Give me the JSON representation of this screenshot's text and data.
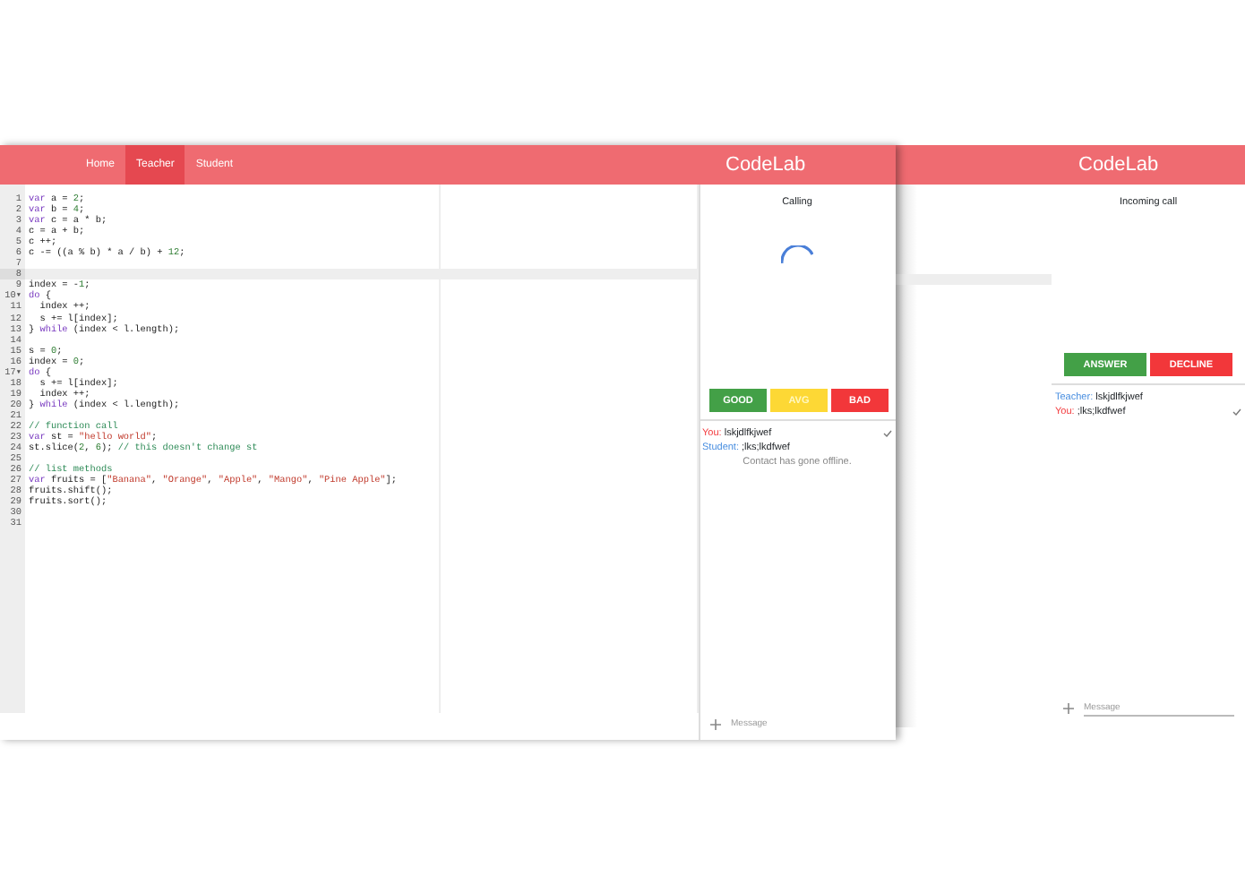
{
  "editor_app": {
    "nav": [
      {
        "label": "Home",
        "selected": false
      },
      {
        "label": "Teacher",
        "selected": true
      },
      {
        "label": "Student",
        "selected": false
      }
    ],
    "code": [
      {
        "number": "1",
        "tokens": [
          {
            "kind": "kw",
            "text": "var"
          },
          {
            "kind": "plain",
            "text": " a = "
          },
          {
            "kind": "num",
            "text": "2"
          },
          {
            "kind": "plain",
            "text": ";"
          }
        ]
      },
      {
        "number": "2",
        "tokens": [
          {
            "kind": "kw",
            "text": "var"
          },
          {
            "kind": "plain",
            "text": " b = "
          },
          {
            "kind": "num",
            "text": "4"
          },
          {
            "kind": "plain",
            "text": ";"
          }
        ]
      },
      {
        "number": "3",
        "tokens": [
          {
            "kind": "kw",
            "text": "var"
          },
          {
            "kind": "plain",
            "text": " c = a * b;"
          }
        ]
      },
      {
        "number": "4",
        "tokens": [
          {
            "kind": "plain",
            "text": "c = a + b;"
          }
        ]
      },
      {
        "number": "5",
        "tokens": [
          {
            "kind": "plain",
            "text": "c ++;"
          }
        ]
      },
      {
        "number": "6",
        "tokens": [
          {
            "kind": "plain",
            "text": "c -= ((a % b) * a / b) + "
          },
          {
            "kind": "num",
            "text": "12"
          },
          {
            "kind": "plain",
            "text": ";"
          }
        ]
      },
      {
        "number": "7"
      },
      {
        "number": "8",
        "active": true
      },
      {
        "number": "9",
        "tokens": [
          {
            "kind": "plain",
            "text": "index = -"
          },
          {
            "kind": "num",
            "text": "1"
          },
          {
            "kind": "plain",
            "text": ";"
          }
        ]
      },
      {
        "number": "10",
        "fold": "▾",
        "tokens": [
          {
            "kind": "kw",
            "text": "do"
          },
          {
            "kind": "plain",
            "text": " {"
          }
        ]
      },
      {
        "number": "11",
        "tokens": [
          {
            "kind": "plain",
            "text": "  index ++;"
          }
        ]
      },
      {
        "number": "12",
        "tokens": [
          {
            "kind": "plain",
            "text": "  s += l[index];"
          }
        ]
      },
      {
        "number": "13",
        "tokens": [
          {
            "kind": "plain",
            "text": "} "
          },
          {
            "kind": "kw",
            "text": "while"
          },
          {
            "kind": "plain",
            "text": " (index < l.length);"
          }
        ]
      },
      {
        "number": "14"
      },
      {
        "number": "15",
        "tokens": [
          {
            "kind": "plain",
            "text": "s = "
          },
          {
            "kind": "num",
            "text": "0"
          },
          {
            "kind": "plain",
            "text": ";"
          }
        ]
      },
      {
        "number": "16",
        "tokens": [
          {
            "kind": "plain",
            "text": "index = "
          },
          {
            "kind": "num",
            "text": "0"
          },
          {
            "kind": "plain",
            "text": ";"
          }
        ]
      },
      {
        "number": "17",
        "fold": "▾",
        "tokens": [
          {
            "kind": "kw",
            "text": "do"
          },
          {
            "kind": "plain",
            "text": " {"
          }
        ]
      },
      {
        "number": "18",
        "tokens": [
          {
            "kind": "plain",
            "text": "  s += l[index];"
          }
        ]
      },
      {
        "number": "19",
        "tokens": [
          {
            "kind": "plain",
            "text": "  index ++;"
          }
        ]
      },
      {
        "number": "20",
        "tokens": [
          {
            "kind": "plain",
            "text": "} "
          },
          {
            "kind": "kw",
            "text": "while"
          },
          {
            "kind": "plain",
            "text": " (index < l.length);"
          }
        ]
      },
      {
        "number": "21"
      },
      {
        "number": "22",
        "tokens": [
          {
            "kind": "cmt",
            "text": "// function call"
          }
        ]
      },
      {
        "number": "23",
        "tokens": [
          {
            "kind": "kw",
            "text": "var"
          },
          {
            "kind": "plain",
            "text": " st = "
          },
          {
            "kind": "str",
            "text": "\"hello world\""
          },
          {
            "kind": "plain",
            "text": ";"
          }
        ]
      },
      {
        "number": "24",
        "tokens": [
          {
            "kind": "plain",
            "text": "st.slice("
          },
          {
            "kind": "num",
            "text": "2"
          },
          {
            "kind": "plain",
            "text": ", "
          },
          {
            "kind": "num",
            "text": "6"
          },
          {
            "kind": "plain",
            "text": "); "
          },
          {
            "kind": "cmt",
            "text": "// this doesn't change st"
          }
        ]
      },
      {
        "number": "25"
      },
      {
        "number": "26",
        "tokens": [
          {
            "kind": "cmt",
            "text": "// list methods"
          }
        ]
      },
      {
        "number": "27",
        "tokens": [
          {
            "kind": "kw",
            "text": "var"
          },
          {
            "kind": "plain",
            "text": " fruits = ["
          },
          {
            "kind": "str",
            "text": "\"Banana\""
          },
          {
            "kind": "plain",
            "text": ", "
          },
          {
            "kind": "str",
            "text": "\"Orange\""
          },
          {
            "kind": "plain",
            "text": ", "
          },
          {
            "kind": "str",
            "text": "\"Apple\""
          },
          {
            "kind": "plain",
            "text": ", "
          },
          {
            "kind": "str",
            "text": "\"Mango\""
          },
          {
            "kind": "plain",
            "text": ", "
          },
          {
            "kind": "str",
            "text": "\"Pine Apple\""
          },
          {
            "kind": "plain",
            "text": "];"
          }
        ]
      },
      {
        "number": "28",
        "tokens": [
          {
            "kind": "plain",
            "text": "fruits.shift();"
          }
        ]
      },
      {
        "number": "29",
        "tokens": [
          {
            "kind": "plain",
            "text": "fruits.sort();"
          }
        ]
      },
      {
        "number": "30"
      },
      {
        "number": "31"
      }
    ]
  },
  "call_panels": [
    {
      "title": "CodeLab",
      "status": "Calling",
      "spinner": true,
      "buttons": [
        {
          "label": "GOOD",
          "color": "#43a047"
        },
        {
          "label": "AVG",
          "color": "#fdd835"
        },
        {
          "label": "BAD",
          "color": "#f2373a"
        }
      ],
      "messages": [
        {
          "sender": "You:",
          "kind": "self",
          "text": "lskjdlfkjwef",
          "delivered": true
        },
        {
          "sender": "Student:",
          "kind": "other",
          "text": ";lks;lkdfwef",
          "delivered": false
        }
      ],
      "notice": "Contact has gone offline.",
      "input": {
        "placeholder": "Message"
      }
    },
    {
      "title": "CodeLab",
      "status": "Incoming call",
      "spinner": false,
      "buttons": [
        {
          "label": "ANSWER",
          "color": "#43a047"
        },
        {
          "label": "DECLINE",
          "color": "#f2373a"
        }
      ],
      "messages": [
        {
          "sender": "Teacher:",
          "kind": "other",
          "text": "lskjdlfkjwef",
          "delivered": false
        },
        {
          "sender": "You:",
          "kind": "self",
          "text": ";lks;lkdfwef",
          "delivered": true
        }
      ],
      "input": {
        "placeholder": "Message"
      }
    }
  ]
}
